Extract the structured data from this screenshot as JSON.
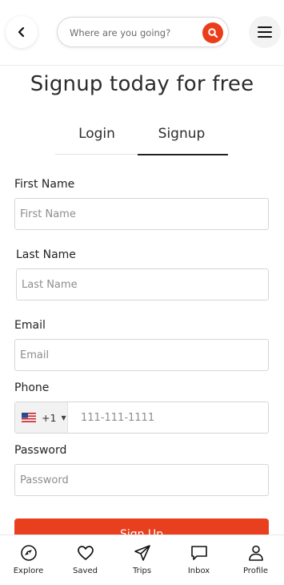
{
  "header": {
    "search_placeholder": "Where are you going?"
  },
  "page": {
    "title": "Signup today for free"
  },
  "tabs": [
    {
      "label": "Login",
      "active": false
    },
    {
      "label": "Signup",
      "active": true
    }
  ],
  "form": {
    "first_name": {
      "label": "First Name",
      "placeholder": "First Name",
      "value": ""
    },
    "last_name": {
      "label": "Last Name",
      "placeholder": "Last Name",
      "value": ""
    },
    "email": {
      "label": "Email",
      "placeholder": "Email",
      "value": ""
    },
    "phone": {
      "label": "Phone",
      "country_code": "+1",
      "placeholder": "111-111-1111",
      "value": ""
    },
    "password": {
      "label": "Password",
      "placeholder": "Password",
      "value": ""
    },
    "submit_label": "Sign Up"
  },
  "bottom_nav": [
    {
      "label": "Explore",
      "icon": "compass-icon"
    },
    {
      "label": "Saved",
      "icon": "heart-icon"
    },
    {
      "label": "Trips",
      "icon": "paper-plane-icon"
    },
    {
      "label": "Inbox",
      "icon": "chat-bubble-icon"
    },
    {
      "label": "Profile",
      "icon": "user-icon"
    }
  ],
  "colors": {
    "accent": "#ea3e1b",
    "text": "#222222",
    "border": "#d6d6d6"
  }
}
